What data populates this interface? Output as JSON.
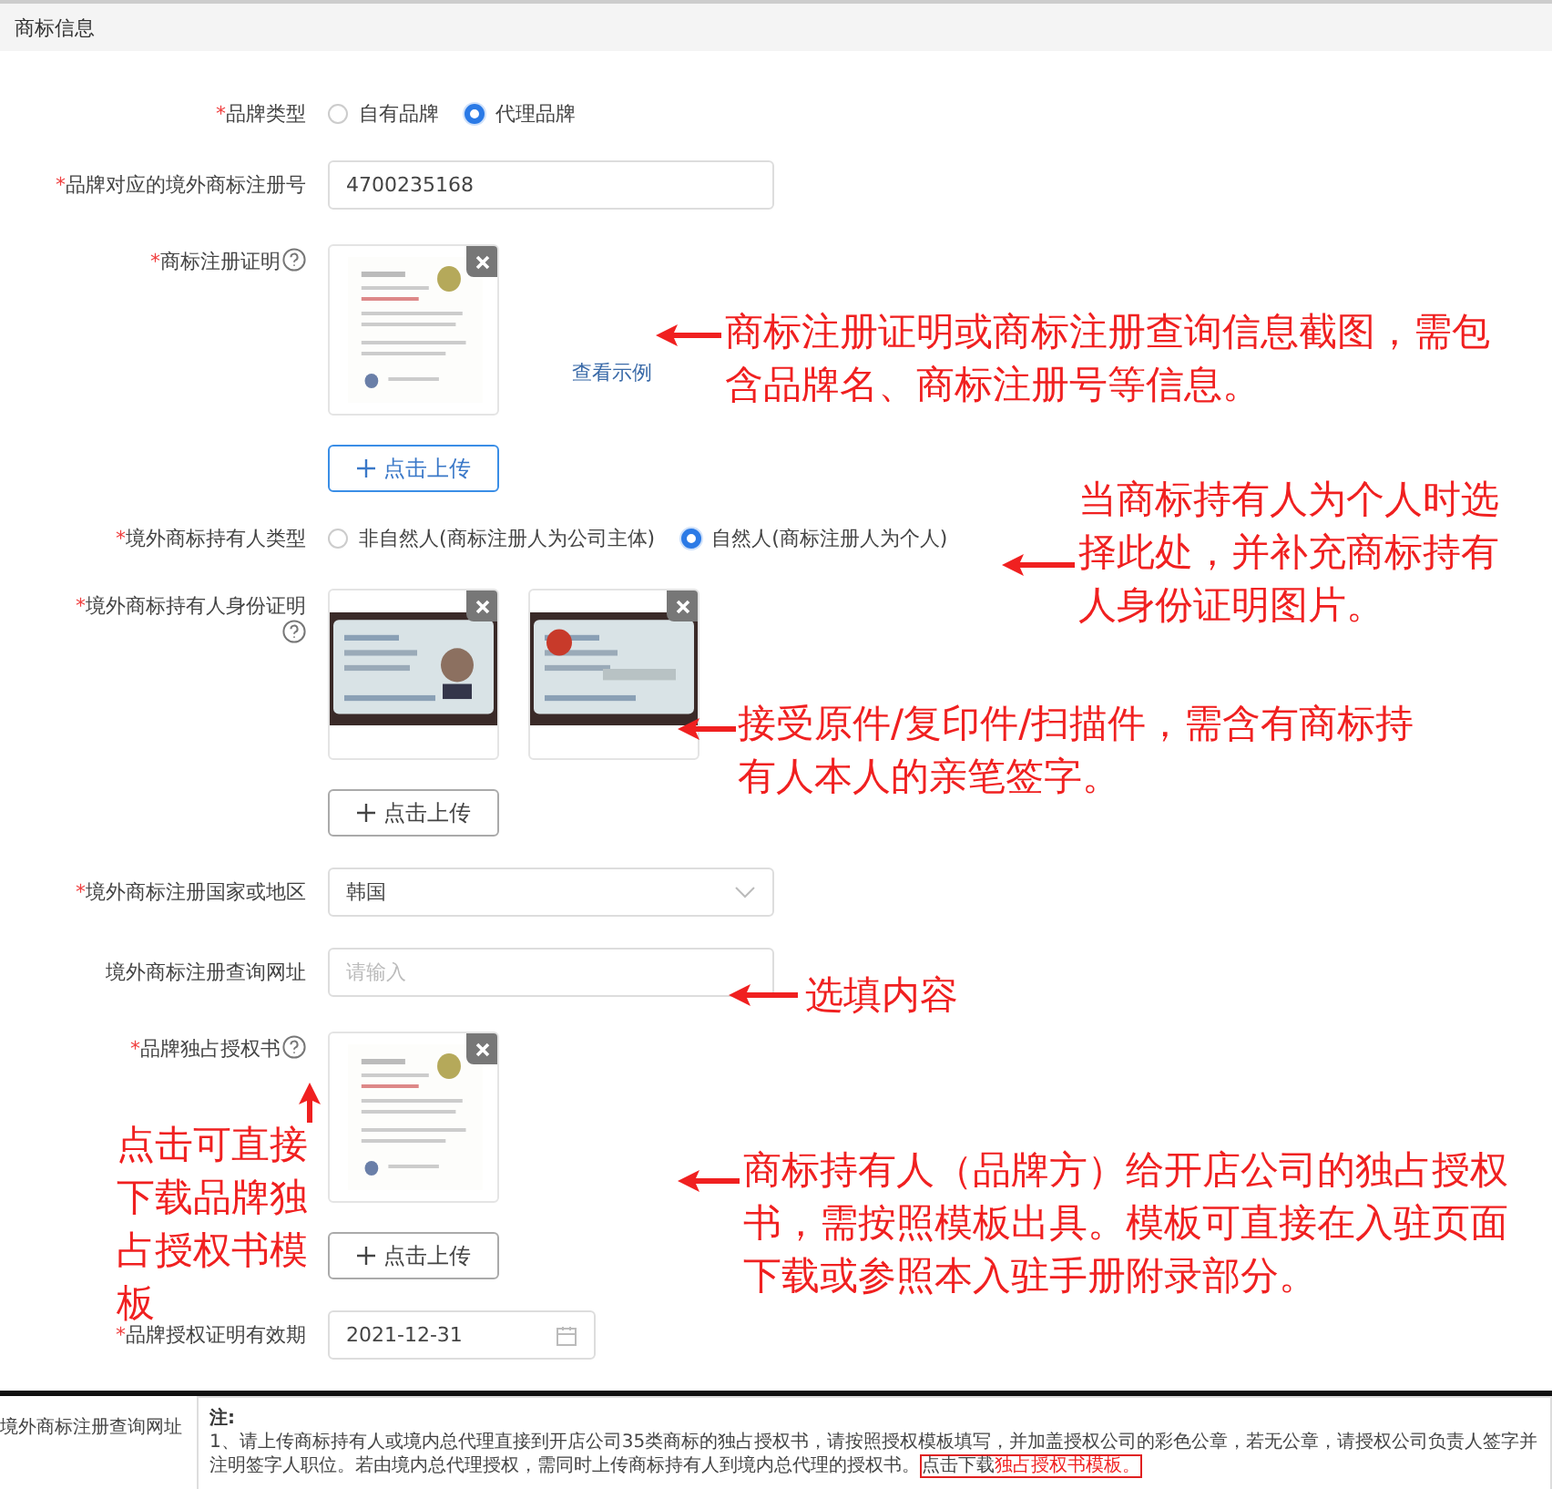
{
  "section": {
    "title": "商标信息"
  },
  "fields": [
    {
      "kind": "radio",
      "required_mark": "*",
      "label": "品牌类型",
      "options": [
        {
          "label": "自有品牌",
          "selected": false
        },
        {
          "label": "代理品牌",
          "selected": true
        }
      ]
    },
    {
      "kind": "input",
      "required_mark": "*",
      "label": "品牌对应的境外商标注册号",
      "value": "4700235168"
    },
    {
      "kind": "upload",
      "required_mark": "*",
      "label": "商标注册证明",
      "help": true,
      "example_link": "查看示例",
      "upload_button": "点击上传"
    },
    {
      "kind": "radio",
      "required_mark": "*",
      "label": "境外商标持有人类型",
      "options": [
        {
          "label": "非自然人(商标注册人为公司主体)",
          "selected": false
        },
        {
          "label": "自然人(商标注册人为个人)",
          "selected": true
        }
      ]
    },
    {
      "kind": "upload",
      "required_mark": "*",
      "label": "境外商标持有人身份证明",
      "help": true,
      "upload_button": "点击上传"
    },
    {
      "kind": "select",
      "required_mark": "*",
      "label": "境外商标注册国家或地区",
      "value": "韩国"
    },
    {
      "kind": "input",
      "label": "境外商标注册查询网址",
      "placeholder": "请输入"
    },
    {
      "kind": "upload",
      "required_mark": "*",
      "label": "品牌独占授权书",
      "help": true,
      "upload_button": "点击上传"
    },
    {
      "kind": "date",
      "required_mark": "*",
      "label": "品牌授权证明有效期",
      "value": "2021-12-31"
    }
  ],
  "annotations": [
    {
      "text": "商标注册证明或商标注册查询信息截图，需包含品牌名、商标注册号等信息。"
    },
    {
      "text": "当商标持有人为个人时选择此处，并补充商标持有人身份证明图片。"
    },
    {
      "text": "接受原件/复印件/扫描件，需含有商标持有人本人的亲笔签字。"
    },
    {
      "text": "选填内容"
    },
    {
      "text": "点击可直接下载品牌独占授权书模板"
    },
    {
      "text": "商标持有人（品牌方）给开店公司的独占授权书，需按照模板出具。模板可直接在入驻页面下载或参照本入驻手册附录部分。"
    }
  ],
  "notice": {
    "label": "境外商标注册查询网址",
    "title": "注:",
    "text": "1、请上传商标持有人或境内总代理直接到开店公司35类商标的独占授权书，请按照授权模板填写，并加盖授权公司的彩色公章，若无公章，请授权公司负责人签字并注明签字人职位。若由境内总代理授权，需同时上传商标持有人到境内总代理的授权书。",
    "link_prefix": "点击下载",
    "link": "独占授权书模板。"
  }
}
